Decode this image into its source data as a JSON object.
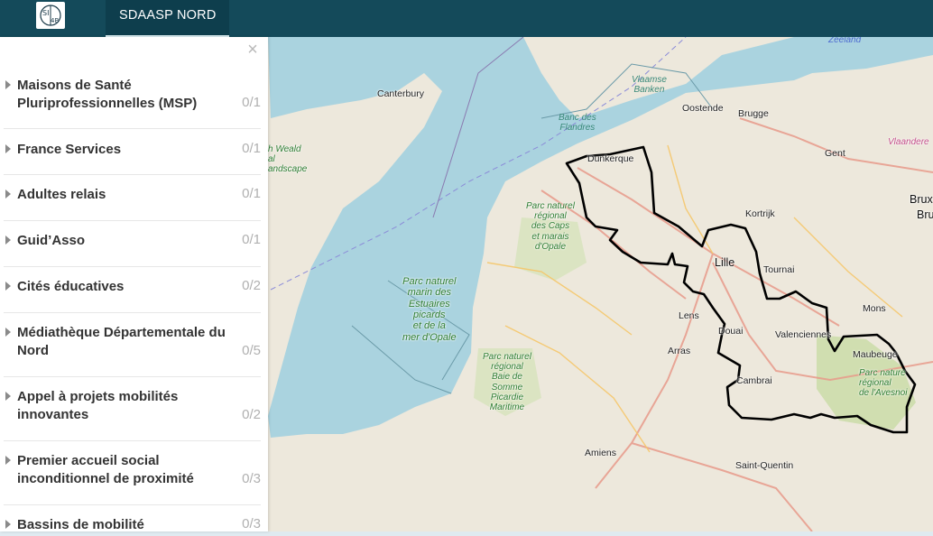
{
  "header": {
    "logo_text": "SIG 4B",
    "nav_tab": "SDAASP NORD"
  },
  "panel": {
    "close_glyph": "×",
    "items": [
      {
        "label": "Maisons de Santé Pluriprofessionnelles (MSP)",
        "count": "0/1"
      },
      {
        "label": "France Services",
        "count": "0/1"
      },
      {
        "label": "Adultes relais",
        "count": "0/1"
      },
      {
        "label": "Guid’Asso",
        "count": "0/1"
      },
      {
        "label": "Cités éducatives",
        "count": "0/2"
      },
      {
        "label": "Médiathèque Départementale du Nord",
        "count": "0/5"
      },
      {
        "label": "Appel à projets mobilités innovantes",
        "count": "0/2"
      },
      {
        "label": "Premier accueil social inconditionnel de proximité",
        "count": "0/3"
      },
      {
        "label": "Bassins de mobilité",
        "count": "0/3"
      }
    ]
  },
  "map": {
    "colors": {
      "sea": "#aad3df",
      "land": "#ede8dc",
      "border": "#000000",
      "park": "#c8dba5"
    },
    "cities": {
      "canterbury": "Canterbury",
      "oostende": "Oostende",
      "brugge": "Brugge",
      "gent": "Gent",
      "dunkerque": "Dunkerque",
      "kortrijk": "Kortrijk",
      "lille": "Lille",
      "tournai": "Tournai",
      "lens": "Lens",
      "douai": "Douai",
      "arras": "Arras",
      "valenciennes": "Valenciennes",
      "mons": "Mons",
      "maubeuge": "Maubeuge",
      "cambrai": "Cambrai",
      "amiens": "Amiens",
      "saint_quentin": "Saint-Quentin",
      "brux1": "Brux",
      "brux2": "Bru"
    },
    "regions": {
      "vlaanderen": "Vlaandere",
      "zeeland": "Zeeland"
    },
    "parks": {
      "vlaamse_banken": "Vlaamse\nBanken",
      "banc_des_flandres": "Banc des\nFlandres",
      "weald": "h Weald\nal\nandscape",
      "caps": "Parc naturel\nrégional\ndes Caps\net marais\nd'Opale",
      "marin": "Parc naturel\nmarin des\nEstuaires\npicards\net de la\nmer d'Opale",
      "baie_somme": "Parc naturel\nrégional\nBaie de\nSomme\nPicardie\nMaritime",
      "avesnois": "Parc nature\nrégional\nde l'Avesnoi"
    }
  }
}
